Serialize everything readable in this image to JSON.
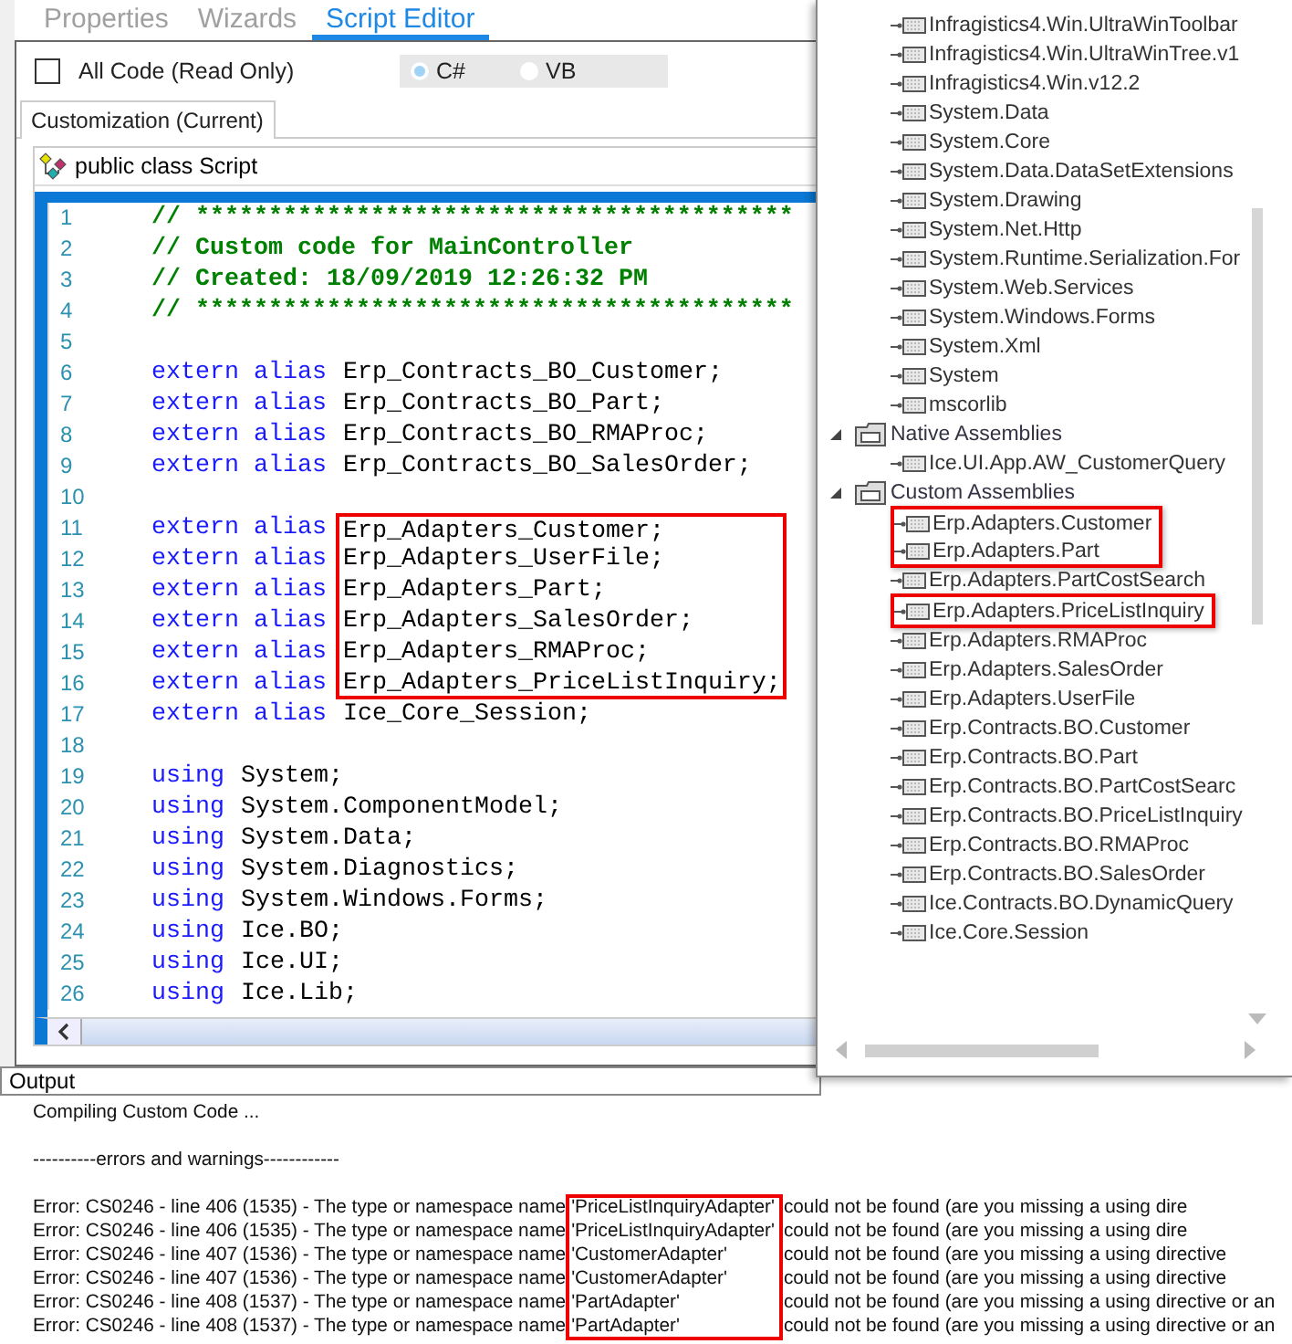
{
  "tabs": [
    {
      "label": "Properties",
      "selected": false
    },
    {
      "label": "Wizards",
      "selected": false
    },
    {
      "label": "Script Editor",
      "selected": true
    }
  ],
  "all_code": {
    "label": "All Code (Read Only)",
    "checked": false
  },
  "language": [
    {
      "label": "C#",
      "selected": true
    },
    {
      "label": "VB",
      "selected": false
    }
  ],
  "editor_tabs": [
    {
      "label": "Customization (Current)",
      "selected": true
    }
  ],
  "class_selector": {
    "value": "public class Script"
  },
  "code_lines": [
    {
      "number": "1",
      "kind": "comment",
      "text": "// *****************************************"
    },
    {
      "number": "2",
      "kind": "comment",
      "text": "// Custom code for MainController"
    },
    {
      "number": "3",
      "kind": "comment",
      "text": "// Created: 18/09/2019 12:26:32 PM"
    },
    {
      "number": "4",
      "kind": "comment",
      "text": "// *****************************************"
    },
    {
      "number": "5",
      "kind": "blank"
    },
    {
      "number": "6",
      "kind": "code",
      "keyword": "extern alias",
      "text": "Erp_Contracts_BO_Customer;",
      "highlight": false
    },
    {
      "number": "7",
      "kind": "code",
      "keyword": "extern alias",
      "text": "Erp_Contracts_BO_Part;",
      "highlight": false
    },
    {
      "number": "8",
      "kind": "code",
      "keyword": "extern alias",
      "text": "Erp_Contracts_BO_RMAProc;",
      "highlight": false
    },
    {
      "number": "9",
      "kind": "code",
      "keyword": "extern alias",
      "text": "Erp_Contracts_BO_SalesOrder;",
      "highlight": false
    },
    {
      "number": "10",
      "kind": "blank"
    },
    {
      "number": "11",
      "kind": "code",
      "keyword": "extern alias",
      "text": "Erp_Adapters_Customer;",
      "highlight": true
    },
    {
      "number": "12",
      "kind": "code",
      "keyword": "extern alias",
      "text": "Erp_Adapters_UserFile;",
      "highlight": true
    },
    {
      "number": "13",
      "kind": "code",
      "keyword": "extern alias",
      "text": "Erp_Adapters_Part;",
      "highlight": true
    },
    {
      "number": "14",
      "kind": "code",
      "keyword": "extern alias",
      "text": "Erp_Adapters_SalesOrder;",
      "highlight": true
    },
    {
      "number": "15",
      "kind": "code",
      "keyword": "extern alias",
      "text": "Erp_Adapters_RMAProc;",
      "highlight": true
    },
    {
      "number": "16",
      "kind": "code",
      "keyword": "extern alias",
      "text": "Erp_Adapters_PriceListInquiry;",
      "highlight": true
    },
    {
      "number": "17",
      "kind": "code",
      "keyword": "extern alias",
      "text": "Ice_Core_Session;",
      "highlight": false
    },
    {
      "number": "18",
      "kind": "blank"
    },
    {
      "number": "19",
      "kind": "code",
      "keyword": "using",
      "text": "System;",
      "highlight": false
    },
    {
      "number": "20",
      "kind": "code",
      "keyword": "using",
      "text": "System.ComponentModel;",
      "highlight": false
    },
    {
      "number": "21",
      "kind": "code",
      "keyword": "using",
      "text": "System.Data;",
      "highlight": false
    },
    {
      "number": "22",
      "kind": "code",
      "keyword": "using",
      "text": "System.Diagnostics;",
      "highlight": false
    },
    {
      "number": "23",
      "kind": "code",
      "keyword": "using",
      "text": "System.Windows.Forms;",
      "highlight": false
    },
    {
      "number": "24",
      "kind": "code",
      "keyword": "using",
      "text": "Ice.BO;",
      "highlight": false
    },
    {
      "number": "25",
      "kind": "code",
      "keyword": "using",
      "text": "Ice.UI;",
      "highlight": false
    },
    {
      "number": "26",
      "kind": "code",
      "keyword": "using",
      "text": "Ice.Lib;",
      "highlight": false
    }
  ],
  "tree": [
    {
      "kind": "leaf",
      "label": "Infragistics4.Win.UltraWinToolbar",
      "highlight": false
    },
    {
      "kind": "leaf",
      "label": "Infragistics4.Win.UltraWinTree.v1",
      "highlight": false
    },
    {
      "kind": "leaf",
      "label": "Infragistics4.Win.v12.2",
      "highlight": false
    },
    {
      "kind": "leaf",
      "label": "System.Data",
      "highlight": false
    },
    {
      "kind": "leaf",
      "label": "System.Core",
      "highlight": false
    },
    {
      "kind": "leaf",
      "label": "System.Data.DataSetExtensions",
      "highlight": false
    },
    {
      "kind": "leaf",
      "label": "System.Drawing",
      "highlight": false
    },
    {
      "kind": "leaf",
      "label": "System.Net.Http",
      "highlight": false
    },
    {
      "kind": "leaf",
      "label": "System.Runtime.Serialization.For",
      "highlight": false
    },
    {
      "kind": "leaf",
      "label": "System.Web.Services",
      "highlight": false
    },
    {
      "kind": "leaf",
      "label": "System.Windows.Forms",
      "highlight": false
    },
    {
      "kind": "leaf",
      "label": "System.Xml",
      "highlight": false
    },
    {
      "kind": "leaf",
      "label": "System",
      "highlight": false
    },
    {
      "kind": "leaf",
      "label": "mscorlib",
      "highlight": false
    },
    {
      "kind": "group",
      "label": "Native Assemblies",
      "expanded": true,
      "children": [
        {
          "kind": "leaf",
          "label": "Ice.UI.App.AW_CustomerQuery",
          "highlight": false
        }
      ]
    },
    {
      "kind": "group",
      "label": "Custom Assemblies",
      "expanded": true,
      "children": [
        {
          "kind": "leaf",
          "label": "Erp.Adapters.Customer",
          "highlight": true
        },
        {
          "kind": "leaf",
          "label": "Erp.Adapters.Part",
          "highlight": true
        },
        {
          "kind": "leaf",
          "label": "Erp.Adapters.PartCostSearch",
          "highlight": false
        },
        {
          "kind": "leaf",
          "label": "Erp.Adapters.PriceListInquiry",
          "highlight": true
        },
        {
          "kind": "leaf",
          "label": "Erp.Adapters.RMAProc",
          "highlight": false
        },
        {
          "kind": "leaf",
          "label": "Erp.Adapters.SalesOrder",
          "highlight": false
        },
        {
          "kind": "leaf",
          "label": "Erp.Adapters.UserFile",
          "highlight": false
        },
        {
          "kind": "leaf",
          "label": "Erp.Contracts.BO.Customer",
          "highlight": false
        },
        {
          "kind": "leaf",
          "label": "Erp.Contracts.BO.Part",
          "highlight": false
        },
        {
          "kind": "leaf",
          "label": "Erp.Contracts.BO.PartCostSearc",
          "highlight": false
        },
        {
          "kind": "leaf",
          "label": "Erp.Contracts.BO.PriceListInquiry",
          "highlight": false
        },
        {
          "kind": "leaf",
          "label": "Erp.Contracts.BO.RMAProc",
          "highlight": false
        },
        {
          "kind": "leaf",
          "label": "Erp.Contracts.BO.SalesOrder",
          "highlight": false
        },
        {
          "kind": "leaf",
          "label": "Ice.Contracts.BO.DynamicQuery",
          "highlight": false
        },
        {
          "kind": "leaf",
          "label": "Ice.Core.Session",
          "highlight": false
        }
      ]
    }
  ],
  "output": {
    "title": "Output",
    "lines": [
      {
        "kind": "text",
        "text": "Compiling Custom Code ..."
      },
      {
        "kind": "blank"
      },
      {
        "kind": "text",
        "text": "----------errors and warnings------------"
      },
      {
        "kind": "blank"
      },
      {
        "kind": "error",
        "prefix": "Error: CS0246 - line 406 (1535) - The type or namespace name",
        "name": "'PriceListInquiryAdapter'",
        "suffix": "could not be found (are you missing a using dire",
        "highlight": true
      },
      {
        "kind": "error",
        "prefix": "Error: CS0246 - line 406 (1535) - The type or namespace name",
        "name": "'PriceListInquiryAdapter'",
        "suffix": "could not be found (are you missing a using dire",
        "highlight": true
      },
      {
        "kind": "error",
        "prefix": "Error: CS0246 - line 407 (1536) - The type or namespace name",
        "name": "'CustomerAdapter'",
        "suffix": "could not be found (are you missing a using directive",
        "highlight": true
      },
      {
        "kind": "error",
        "prefix": "Error: CS0246 - line 407 (1536) - The type or namespace name",
        "name": "'CustomerAdapter'",
        "suffix": "could not be found (are you missing a using directive",
        "highlight": true
      },
      {
        "kind": "error",
        "prefix": "Error: CS0246 - line 408 (1537) - The type or namespace name",
        "name": "'PartAdapter'",
        "suffix": "could not be found (are you missing a using directive or an",
        "highlight": true
      },
      {
        "kind": "error",
        "prefix": "Error: CS0246 - line 408 (1537) - The type or namespace name",
        "name": "'PartAdapter'",
        "suffix": "could not be found (are you missing a using directive or an",
        "highlight": true
      }
    ]
  }
}
